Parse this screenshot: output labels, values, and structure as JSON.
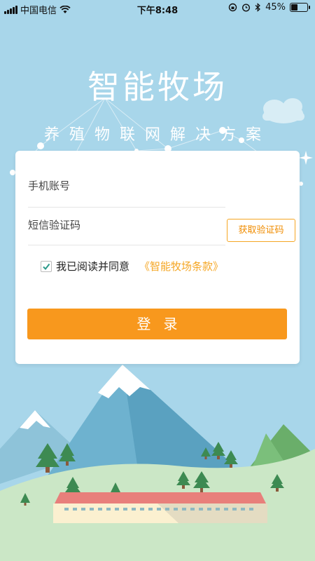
{
  "status_bar": {
    "carrier": "中国电信",
    "time": "下午8:48",
    "battery": "45%",
    "battery_level": 0.45
  },
  "header": {
    "title": "智能牧场",
    "subtitle": "养殖物联网解决方案"
  },
  "login_form": {
    "phone_placeholder": "手机账号",
    "code_placeholder": "短信验证码",
    "get_code_label": "获取验证码",
    "agree_label": "我已阅读并同意",
    "terms_link": "《智能牧场条款》",
    "agree_checked": true,
    "login_label": "登录"
  },
  "colors": {
    "sky": "#a8d6ea",
    "accent": "#f8981d",
    "checkbox": "#2c9a8a"
  }
}
